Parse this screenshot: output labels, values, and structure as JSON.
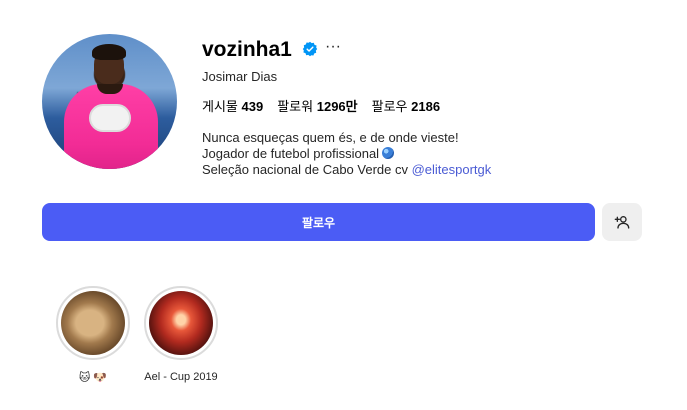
{
  "profile": {
    "username": "vozinha1",
    "full_name": "Josimar Dias",
    "verified": true,
    "stats": {
      "posts_label": "게시물",
      "posts_value": "439",
      "followers_label": "팔로워",
      "followers_value": "1296만",
      "following_label": "팔로우",
      "following_value": "2186"
    },
    "bio": {
      "line1": "Nunca esqueças quem és, e de onde vieste!",
      "line2": "Jogador de futebol profissional",
      "line3_text": "Seleção nacional de Cabo Verde cv ",
      "line3_link": "@elitesportgk"
    }
  },
  "actions": {
    "follow_label": "팔로우",
    "more_label": "···"
  },
  "highlights": [
    {
      "label": "🐱 🐶"
    },
    {
      "label": "Ael - Cup 2019"
    }
  ],
  "colors": {
    "primary_button": "#4b5cf5",
    "secondary_button": "#efefef",
    "verified_badge": "#0095f6",
    "link": "#4a5bd4"
  },
  "icons": {
    "verified": "verified-badge-icon",
    "more": "more-options-icon",
    "suggest": "add-person-icon"
  }
}
